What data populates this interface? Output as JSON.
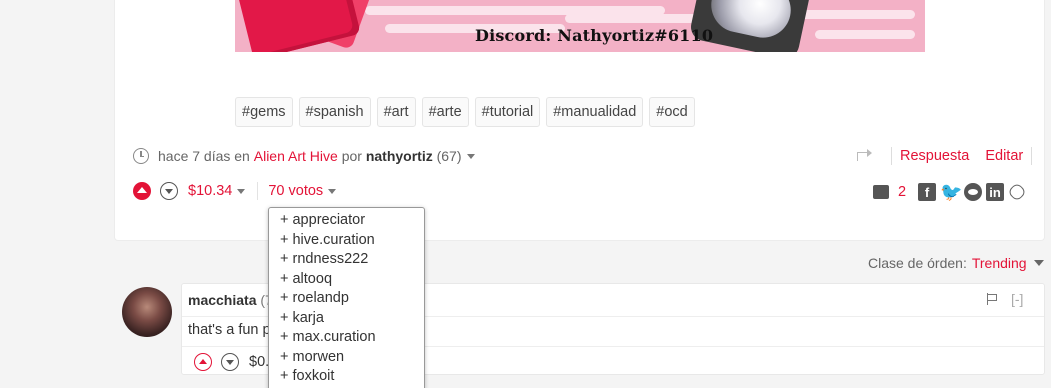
{
  "banner": {
    "text": "Discord: Nathyortiz#6110"
  },
  "tags": [
    "#gems",
    "#spanish",
    "#art",
    "#arte",
    "#tutorial",
    "#manualidad",
    "#ocd"
  ],
  "meta": {
    "time": "hace 7 días en",
    "community": "Alien Art Hive",
    "by": "por",
    "author": "nathyortiz",
    "reputation": "(67)"
  },
  "actions": {
    "reply": "Respuesta",
    "edit": "Editar"
  },
  "votes": {
    "payout": "$10.34",
    "count_label": "70 votos",
    "voters": [
      "+ appreciator",
      "+ hive.curation",
      "+ rndness222",
      "+ altooq",
      "+ roelandp",
      "+ karja",
      "+ max.curation",
      "+ morwen",
      "+ foxkoit"
    ]
  },
  "share": {
    "comment_count": "2"
  },
  "sort": {
    "label": "Clase de órden:",
    "selected": "Trending"
  },
  "comment": {
    "author": "macchiata",
    "reputation": "(7",
    "collapse": "[-]",
    "body": "that's a fun p",
    "payout": "$0."
  },
  "colors": {
    "accent": "#e31337"
  }
}
